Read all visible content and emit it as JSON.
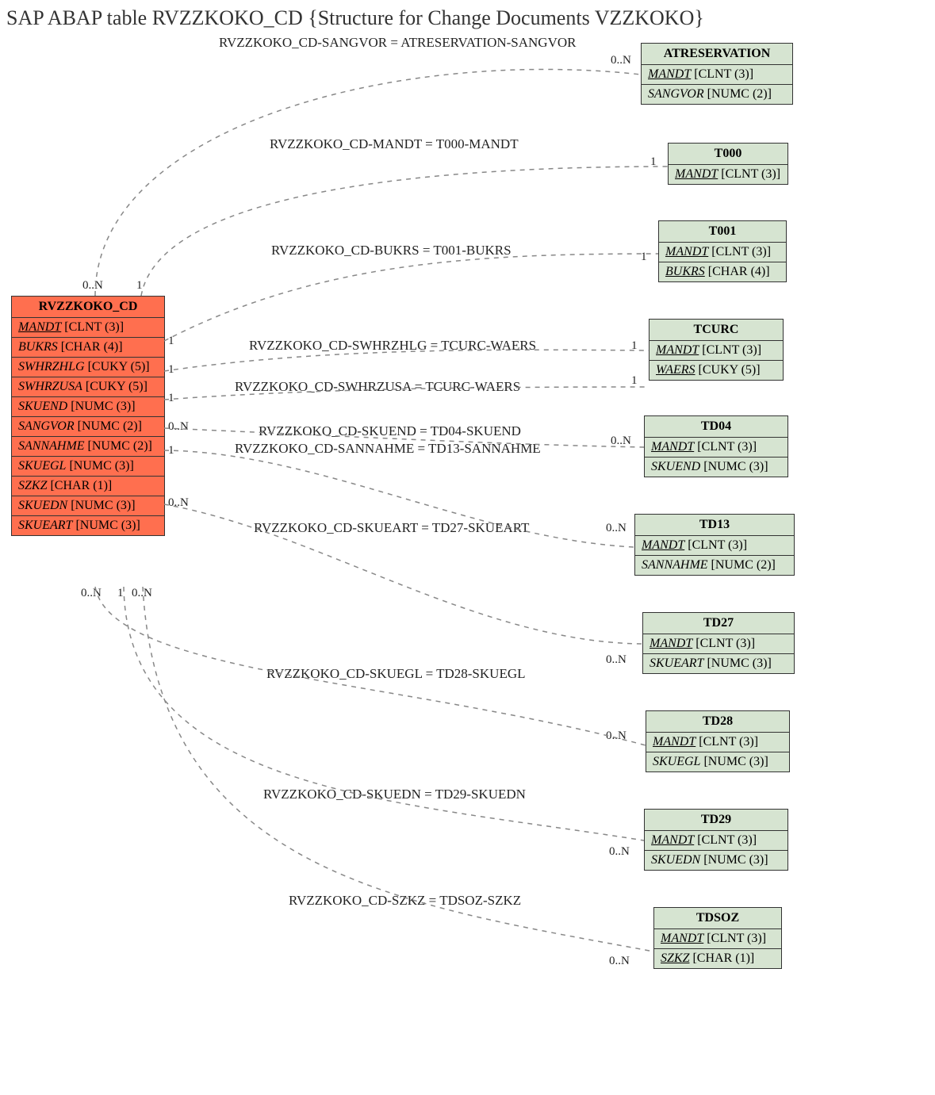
{
  "title": "SAP ABAP table RVZZKOKO_CD {Structure for Change Documents VZZKOKO}",
  "main": {
    "name": "RVZZKOKO_CD",
    "fields": [
      {
        "name": "MANDT",
        "type": "[CLNT (3)]",
        "key": true
      },
      {
        "name": "BUKRS",
        "type": "[CHAR (4)]",
        "key": false
      },
      {
        "name": "SWHRZHLG",
        "type": "[CUKY (5)]",
        "key": false
      },
      {
        "name": "SWHRZUSA",
        "type": "[CUKY (5)]",
        "key": false
      },
      {
        "name": "SKUEND",
        "type": "[NUMC (3)]",
        "key": false
      },
      {
        "name": "SANGVOR",
        "type": "[NUMC (2)]",
        "key": false
      },
      {
        "name": "SANNAHME",
        "type": "[NUMC (2)]",
        "key": false
      },
      {
        "name": "SKUEGL",
        "type": "[NUMC (3)]",
        "key": false
      },
      {
        "name": "SZKZ",
        "type": "[CHAR (1)]",
        "key": false
      },
      {
        "name": "SKUEDN",
        "type": "[NUMC (3)]",
        "key": false
      },
      {
        "name": "SKUEART",
        "type": "[NUMC (3)]",
        "key": false
      }
    ]
  },
  "targets": [
    {
      "name": "ATRESERVATION",
      "fields": [
        {
          "name": "MANDT",
          "type": "[CLNT (3)]",
          "key": true
        },
        {
          "name": "SANGVOR",
          "type": "[NUMC (2)]",
          "key": false
        }
      ]
    },
    {
      "name": "T000",
      "fields": [
        {
          "name": "MANDT",
          "type": "[CLNT (3)]",
          "key": true
        }
      ]
    },
    {
      "name": "T001",
      "fields": [
        {
          "name": "MANDT",
          "type": "[CLNT (3)]",
          "key": true
        },
        {
          "name": "BUKRS",
          "type": "[CHAR (4)]",
          "key": true
        }
      ]
    },
    {
      "name": "TCURC",
      "fields": [
        {
          "name": "MANDT",
          "type": "[CLNT (3)]",
          "key": true
        },
        {
          "name": "WAERS",
          "type": "[CUKY (5)]",
          "key": true
        }
      ]
    },
    {
      "name": "TD04",
      "fields": [
        {
          "name": "MANDT",
          "type": "[CLNT (3)]",
          "key": true
        },
        {
          "name": "SKUEND",
          "type": "[NUMC (3)]",
          "key": false
        }
      ]
    },
    {
      "name": "TD13",
      "fields": [
        {
          "name": "MANDT",
          "type": "[CLNT (3)]",
          "key": true
        },
        {
          "name": "SANNAHME",
          "type": "[NUMC (2)]",
          "key": false
        }
      ]
    },
    {
      "name": "TD27",
      "fields": [
        {
          "name": "MANDT",
          "type": "[CLNT (3)]",
          "key": true
        },
        {
          "name": "SKUEART",
          "type": "[NUMC (3)]",
          "key": false
        }
      ]
    },
    {
      "name": "TD28",
      "fields": [
        {
          "name": "MANDT",
          "type": "[CLNT (3)]",
          "key": true
        },
        {
          "name": "SKUEGL",
          "type": "[NUMC (3)]",
          "key": false
        }
      ]
    },
    {
      "name": "TD29",
      "fields": [
        {
          "name": "MANDT",
          "type": "[CLNT (3)]",
          "key": true
        },
        {
          "name": "SKUEDN",
          "type": "[NUMC (3)]",
          "key": false
        }
      ]
    },
    {
      "name": "TDSOZ",
      "fields": [
        {
          "name": "MANDT",
          "type": "[CLNT (3)]",
          "key": true
        },
        {
          "name": "SZKZ",
          "type": "[CHAR (1)]",
          "key": true
        }
      ]
    }
  ],
  "relations": [
    {
      "label": "RVZZKOKO_CD-SANGVOR = ATRESERVATION-SANGVOR",
      "left": "0..N",
      "right": "0..N"
    },
    {
      "label": "RVZZKOKO_CD-MANDT = T000-MANDT",
      "left": "1",
      "right": "1"
    },
    {
      "label": "RVZZKOKO_CD-BUKRS = T001-BUKRS",
      "left": "1",
      "right": "1"
    },
    {
      "label": "RVZZKOKO_CD-SWHRZHLG = TCURC-WAERS",
      "left": "1",
      "right": "1"
    },
    {
      "label": "RVZZKOKO_CD-SWHRZUSA = TCURC-WAERS",
      "left": "1",
      "right": "1"
    },
    {
      "label": "RVZZKOKO_CD-SKUEND = TD04-SKUEND",
      "left": "0..N",
      "right": "0..N"
    },
    {
      "label": "RVZZKOKO_CD-SANNAHME = TD13-SANNAHME",
      "left": "1",
      "right": ""
    },
    {
      "label": "RVZZKOKO_CD-SKUEART = TD27-SKUEART",
      "left": "0..N",
      "right": "0..N"
    },
    {
      "label": "RVZZKOKO_CD-SKUEGL = TD28-SKUEGL",
      "left": "0..N",
      "right": "0..N"
    },
    {
      "label": "RVZZKOKO_CD-SKUEDN = TD29-SKUEDN",
      "left": "0..N",
      "right": "0..N"
    },
    {
      "label": "RVZZKOKO_CD-SZKZ = TDSOZ-SZKZ",
      "left": "1",
      "right": "0..N"
    },
    {
      "label": "",
      "left": "0..N",
      "right": ""
    }
  ]
}
